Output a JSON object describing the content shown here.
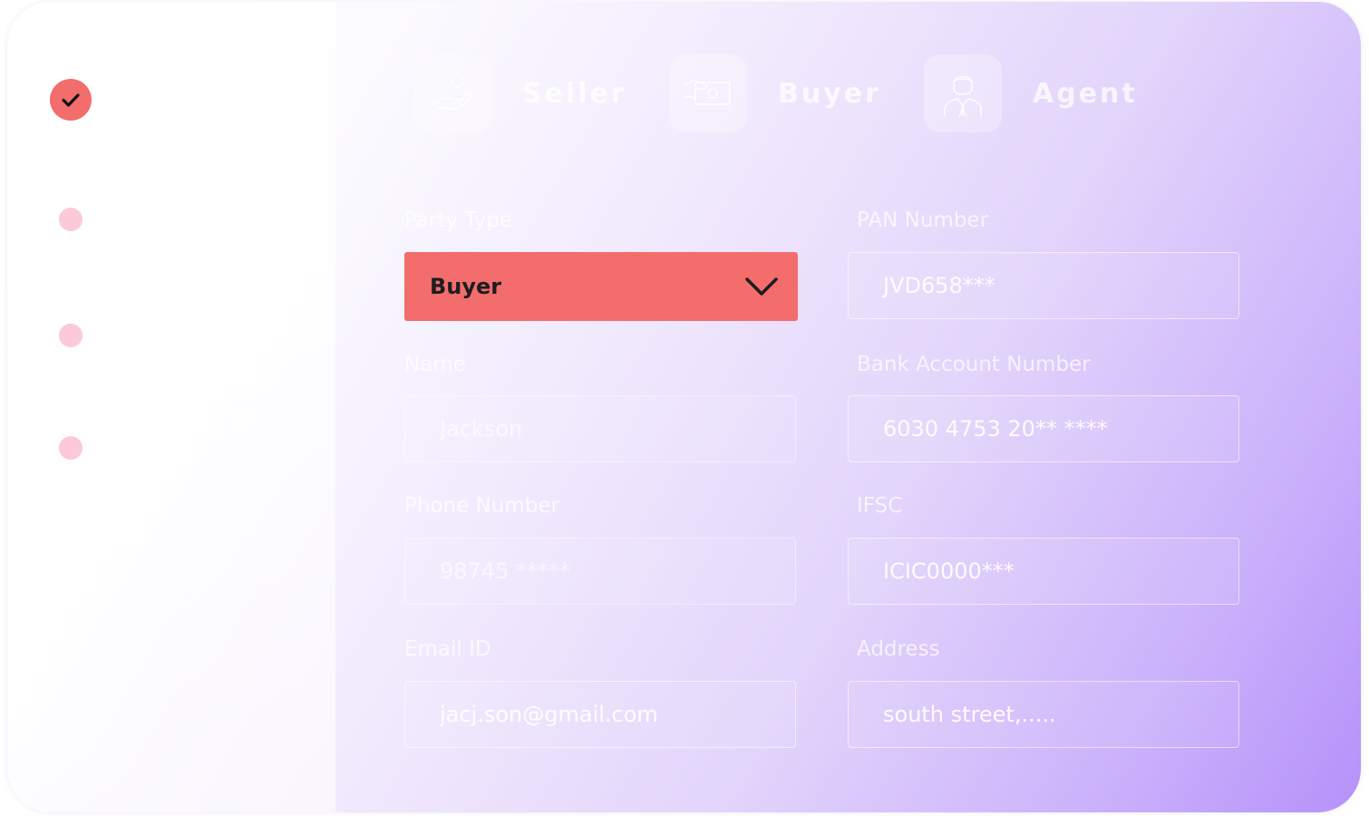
{
  "colors": {
    "accent": "#f26d6c",
    "step_dot": "#fbc9d7",
    "gradient_end": "#b591fa"
  },
  "steps": [
    {
      "status": "complete",
      "label": ""
    },
    {
      "status": "pending",
      "label": ""
    },
    {
      "status": "pending",
      "label": ""
    },
    {
      "status": "pending",
      "label": ""
    }
  ],
  "party_tabs": [
    {
      "label": "Seller",
      "icon": "hand-giving-icon"
    },
    {
      "label": "Buyer",
      "icon": "money-hand-icon"
    },
    {
      "label": "Agent",
      "icon": "agent-person-icon"
    }
  ],
  "form": {
    "party_type": {
      "label": "Party Type",
      "value": "Buyer",
      "icon": "chevron-down-icon"
    },
    "pan_number": {
      "label": "PAN Number",
      "value": "JVD658***"
    },
    "name": {
      "label": "Name",
      "value": "Jackson"
    },
    "bank_account": {
      "label": "Bank Account Number",
      "value": "6030 4753 20** ****"
    },
    "phone": {
      "label": "Phone Number",
      "value": "98745 *****"
    },
    "ifsc": {
      "label": "IFSC",
      "value": "ICIC0000***"
    },
    "email": {
      "label": "Email ID",
      "value": "jacj.son@gmail.com"
    },
    "address": {
      "label": "Address",
      "value": "south street,....."
    }
  }
}
